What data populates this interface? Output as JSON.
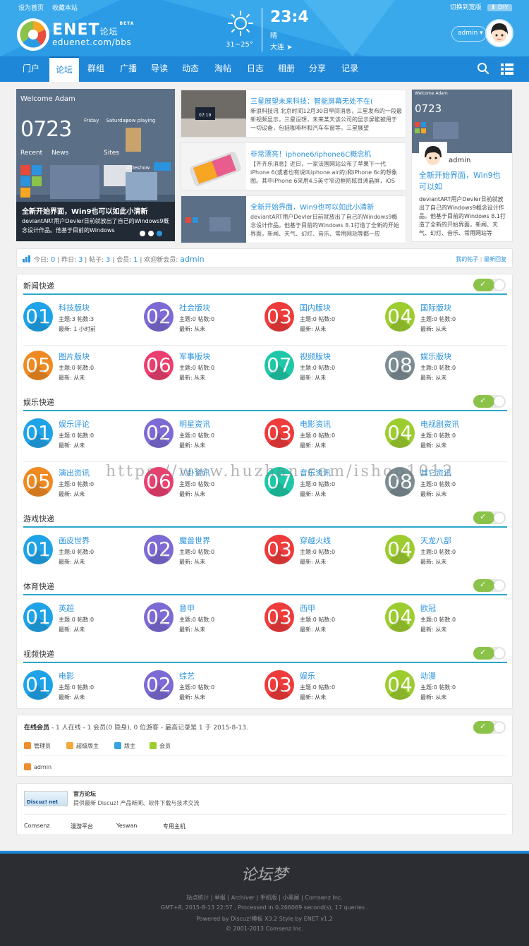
{
  "topbar": {
    "left_links": [
      "设为首页",
      "收藏本站"
    ],
    "switch_width": "切换到宽版",
    "diy": "DIY"
  },
  "logo": {
    "main": "ENET",
    "sub": "论坛",
    "beta": "BETA",
    "url": "eduenet.com/bbs"
  },
  "weather": {
    "time": "23:4",
    "temp": "31~25°",
    "condition": "晴",
    "city": "大连"
  },
  "user": {
    "name": "admin"
  },
  "nav": {
    "items": [
      "门户",
      "论坛",
      "群组",
      "广播",
      "导读",
      "动态",
      "淘帖",
      "日志",
      "相册",
      "分享",
      "记录"
    ],
    "active": 1
  },
  "slider": {
    "welcome": "Welcome Adam",
    "clock": "0723",
    "days": [
      "Friday",
      "Saturday"
    ],
    "now_playing": "now playing",
    "recent": "Recent",
    "news": "News",
    "sites": "Sites",
    "slideshow": "slideshow",
    "caption_title": "全新开始界面，Win9也可以如此小清新",
    "caption_desc": "deviantART用户Devler日前就放出了自己的Windows9概念设计作品。他基于目前的Windows"
  },
  "news": [
    {
      "title": "三星展望未来科技：智能屏幕无处不在(",
      "desc": "新浪科技讯 北京时间12月30日早间消息，三星发布的一段最新视频显示，三星设想，未来某天该公司的显示屏能被用于一切设备，包括咖啡杯和汽车车窗等。三星展望",
      "thumb_time": "07:19"
    },
    {
      "title": "非常漂亮！iphone6/iphone6C概念机",
      "desc": "【齐齐乐消息】近日，一家法国网站公布了苹果下一代iPhone 6(或者也有说叫iphone air的)和iPhone 6c的想象图。其中iPhone 6采用4.5英寸窄边框防眩目涛晶屏，iOS"
    },
    {
      "title": "全新开始界面，Win9也可以如此小清新",
      "desc": "deviantART用户Devler日前就放出了自己的Windows9概念设计作品。他基于目前的Windows 8.1打造了全新的开始界面，新闻、天气、幻灯、音乐、常用网站等都一应"
    }
  ],
  "profile": {
    "name": "admin",
    "title": "全新开始界面，Win9也可以如",
    "desc": "deviantART用户Devler日前就放出了自己的Windows9概念设计作品。他基于目前的Windows 8.1打造了全新的开始界面，新闻、天气、幻灯、音乐、常用网站等",
    "welcome": "Welcome Adam",
    "clock": "0723"
  },
  "stats": {
    "today_label": "今日:",
    "today": "0",
    "yest_label": "昨日:",
    "yest": "3",
    "posts_label": "帖子:",
    "posts": "3",
    "members_label": "会员:",
    "members": "1",
    "welcome_label": "欢迎新会员:",
    "newest": "admin",
    "my_posts": "我的帖子",
    "latest_reply": "最新回复"
  },
  "sections": [
    {
      "title": "新闻快递",
      "forums": [
        {
          "num": "01",
          "name": "科技版块",
          "stats": "主题:3 帖数:3",
          "last": "最新: 1 小时前",
          "color": "#1fa3e8"
        },
        {
          "num": "02",
          "name": "社会版块",
          "stats": "主题:0 帖数:0",
          "last": "最新: 从未",
          "color": "#7d6ad4"
        },
        {
          "num": "03",
          "name": "国内版块",
          "stats": "主题:0 帖数:0",
          "last": "最新: 从未",
          "color": "#ee3b3b"
        },
        {
          "num": "04",
          "name": "国际版块",
          "stats": "主题:0 帖数:0",
          "last": "最新: 从未",
          "color": "#9dcc2f"
        },
        {
          "num": "05",
          "name": "图片版块",
          "stats": "主题:0 帖数:0",
          "last": "最新: 从未",
          "color": "#ef8a22"
        },
        {
          "num": "06",
          "name": "军事版块",
          "stats": "主题:0 帖数:0",
          "last": "最新: 从未",
          "color": "#ea3f6f"
        },
        {
          "num": "07",
          "name": "视频版块",
          "stats": "主题:0 帖数:0",
          "last": "最新: 从未",
          "color": "#1ec7a8"
        },
        {
          "num": "08",
          "name": "娱乐版块",
          "stats": "主题:0 帖数:0",
          "last": "最新: 从未",
          "color": "#7b8c92"
        }
      ]
    },
    {
      "title": "娱乐快递",
      "forums": [
        {
          "num": "01",
          "name": "娱乐评论",
          "stats": "主题:0 帖数:0",
          "last": "最新: 从未",
          "color": "#1fa3e8"
        },
        {
          "num": "02",
          "name": "明星资讯",
          "stats": "主题:0 帖数:0",
          "last": "最新: 从未",
          "color": "#7d6ad4"
        },
        {
          "num": "03",
          "name": "电影资讯",
          "stats": "主题:0 帖数:0",
          "last": "最新: 从未",
          "color": "#ee3b3b"
        },
        {
          "num": "04",
          "name": "电视剧资讯",
          "stats": "主题:0 帖数:0",
          "last": "最新: 从未",
          "color": "#9dcc2f"
        },
        {
          "num": "05",
          "name": "演出资讯",
          "stats": "主题:0 帖数:0",
          "last": "最新: 从未",
          "color": "#ef8a22"
        },
        {
          "num": "06",
          "name": "八卦资讯",
          "stats": "主题:0 帖数:0",
          "last": "最新: 从未",
          "color": "#ea3f6f"
        },
        {
          "num": "07",
          "name": "音乐资讯",
          "stats": "主题:0 帖数:0",
          "last": "最新: 从未",
          "color": "#1ec7a8"
        },
        {
          "num": "08",
          "name": "其它资讯",
          "stats": "主题:0 帖数:0",
          "last": "最新: 从未",
          "color": "#7b8c92"
        }
      ]
    },
    {
      "title": "游戏快递",
      "forums": [
        {
          "num": "01",
          "name": "画皮世界",
          "stats": "主题:0 帖数:0",
          "last": "最新: 从未",
          "color": "#1fa3e8"
        },
        {
          "num": "02",
          "name": "魔兽世界",
          "stats": "主题:0 帖数:0",
          "last": "最新: 从未",
          "color": "#7d6ad4"
        },
        {
          "num": "03",
          "name": "穿越火线",
          "stats": "主题:0 帖数:0",
          "last": "最新: 从未",
          "color": "#ee3b3b"
        },
        {
          "num": "04",
          "name": "天龙八部",
          "stats": "主题:0 帖数:0",
          "last": "最新: 从未",
          "color": "#9dcc2f"
        }
      ]
    },
    {
      "title": "体育快递",
      "forums": [
        {
          "num": "01",
          "name": "英超",
          "stats": "主题:0 帖数:0",
          "last": "最新: 从未",
          "color": "#1fa3e8"
        },
        {
          "num": "02",
          "name": "意甲",
          "stats": "主题:0 帖数:0",
          "last": "最新: 从未",
          "color": "#7d6ad4"
        },
        {
          "num": "03",
          "name": "西甲",
          "stats": "主题:0 帖数:0",
          "last": "最新: 从未",
          "color": "#ee3b3b"
        },
        {
          "num": "04",
          "name": "欧冠",
          "stats": "主题:0 帖数:0",
          "last": "最新: 从未",
          "color": "#9dcc2f"
        }
      ]
    },
    {
      "title": "视频快递",
      "forums": [
        {
          "num": "01",
          "name": "电影",
          "stats": "主题:0 帖数:0",
          "last": "最新: 从未",
          "color": "#1fa3e8"
        },
        {
          "num": "02",
          "name": "综艺",
          "stats": "主题:0 帖数:0",
          "last": "最新: 从未",
          "color": "#7d6ad4"
        },
        {
          "num": "03",
          "name": "娱乐",
          "stats": "主题:0 帖数:0",
          "last": "最新: 从未",
          "color": "#ee3b3b"
        },
        {
          "num": "04",
          "name": "动漫",
          "stats": "主题:0 帖数:0",
          "last": "最新: 从未",
          "color": "#9dcc2f"
        }
      ]
    }
  ],
  "online": {
    "title": "在线会员",
    "summary": "- 1 人在线 - 1 会员(0 隐身), 0 位游客 - 最高记录是 1 于 2015-8-13.",
    "legend": [
      {
        "label": "管理员",
        "color": "#f08c2e"
      },
      {
        "label": "超级版主",
        "color": "#f3a83c"
      },
      {
        "label": "版主",
        "color": "#38a3e0"
      },
      {
        "label": "会员",
        "color": "#9dcc2f"
      }
    ],
    "user": "admin"
  },
  "links": {
    "badge": "Discuz! net",
    "title": "官方论坛",
    "desc": "提供最新 Discuz! 产品新闻、软件下载与技术交流",
    "items": [
      "Comsenz",
      "漫游平台",
      "Yeswan",
      "专用主机"
    ]
  },
  "footer": {
    "signature": "论坛梦",
    "links": "站点统计 | 举报 | Archiver | 手机版 | 小黑屋 | Comsenz Inc.",
    "gmt": "GMT+8, 2015-8-13 22:57 , Processed in 0.266069 second(s), 17 queries .",
    "powered": "Powered by Discuz!模板 X3.2 Style by ENET v1.2",
    "copyright": "© 2001-2013 Comsenz Inc."
  },
  "watermark": "https://www.huzhan.com/ishop1012"
}
